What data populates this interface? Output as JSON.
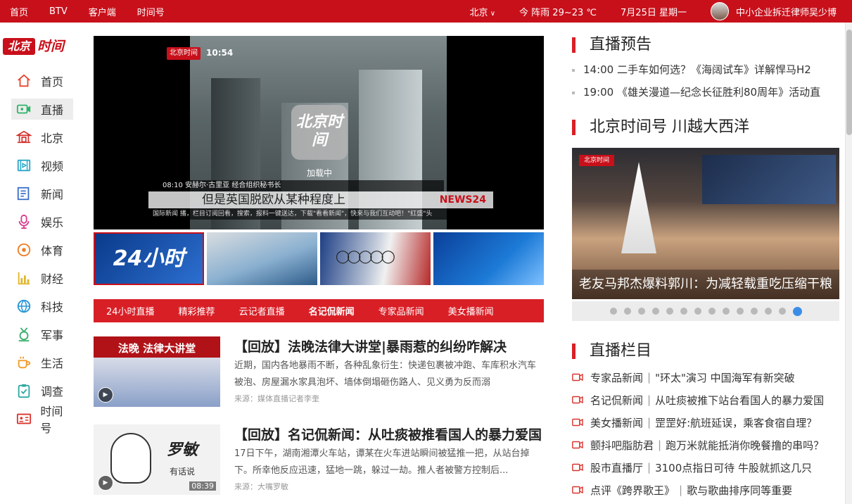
{
  "topbar": {
    "left": [
      "首页",
      "BTV",
      "客户端",
      "时间号"
    ],
    "city": "北京",
    "weather": "今 阵雨 29~23 ℃",
    "date": "7月25日  星期一",
    "user": "中小企业拆迁律师吴少博"
  },
  "logo": {
    "boxed": "北京",
    "rest": "时间"
  },
  "nav": [
    {
      "label": "首页",
      "icon": "home-icon"
    },
    {
      "label": "直播",
      "icon": "live-camera-icon"
    },
    {
      "label": "北京",
      "icon": "beijing-temple-icon"
    },
    {
      "label": "视频",
      "icon": "video-film-icon"
    },
    {
      "label": "新闻",
      "icon": "news-icon"
    },
    {
      "label": "娱乐",
      "icon": "microphone-icon"
    },
    {
      "label": "体育",
      "icon": "ball-icon"
    },
    {
      "label": "财经",
      "icon": "bar-chart-icon"
    },
    {
      "label": "科技",
      "icon": "globe-icon"
    },
    {
      "label": "军事",
      "icon": "medal-icon"
    },
    {
      "label": "生活",
      "icon": "coffee-cup-icon"
    },
    {
      "label": "调查",
      "icon": "clipboard-check-icon"
    },
    {
      "label": "时间号",
      "icon": "id-card-icon"
    }
  ],
  "player": {
    "tv_logo": "北京时间",
    "tv_time": "10:54",
    "caption_top": "08:10  安赫尔·古里亚 经合组织秘书长",
    "caption_main": "但是英国脱欧从某种程度上",
    "caption_brand": "NEWS24",
    "caption_bottom": "国际新闻 播，栏目订阅回看，搜索，报料一键送达，下载\"看看新闻\"，快来与我们互动吧！\"红盛\"头",
    "loader_logo": "北京时间",
    "loading": "加载中"
  },
  "thumbs": {
    "first_label": "24小时"
  },
  "tabs": [
    "24小时直播",
    "精彩推荐",
    "云记者直播",
    "名记侃新闻",
    "专家品新闻",
    "美女播新闻"
  ],
  "news": [
    {
      "img_title": "法晚 法律大讲堂",
      "title": "【回放】法晚法律大讲堂|暴雨惹的纠纷咋解决",
      "desc": "近期，国内各地暴雨不断，各种乱象衍生：快递包裹被冲跑、车库积水汽车被泡、房屋漏水家具泡坏、墙体倒塌砸伤路人、见义勇为反而溺",
      "source": "来源：媒体直播记者李奎"
    },
    {
      "img_title": "罗敏",
      "img_sub": "有话说",
      "duration": "08:39",
      "title": "【回放】名记侃新闻：从吐痰被推看国人的暴力爱国",
      "desc": "17日下午，湖南湘潭火车站，谭某在火车进站瞬间被猛推一把，从站台掉下。所幸他反应迅速，猛地一跳，躲过一劫。推人者被警方控制后...",
      "source": "来源：大嘴罗敏"
    }
  ],
  "right": {
    "preview_title": "直播预告",
    "preview": [
      "14:00 二手车如何选？《海阔试车》详解悍马H2",
      "19:00 《雄关漫道—纪念长征胜利80周年》活动直"
    ],
    "feature_title": "北京时间号 川越大西洋",
    "feature_caption": "老友马邦杰爆料郭川：为减轻载重吃压缩干粮",
    "feature_tag": "北京时间",
    "dots_total": 14,
    "dots_active": 14,
    "columns_title": "直播栏目",
    "columns": [
      {
        "name": "专家品新闻",
        "topic": "\"环太\"演习 中国海军有新突破"
      },
      {
        "name": "名记侃新闻",
        "topic": "从吐痰被推下站台看国人的暴力爱国"
      },
      {
        "name": "美女播新闻",
        "topic": "罡罡好:航班延误，乘客食宿自理？"
      },
      {
        "name": "颤抖吧脂肪君",
        "topic": "跑万米就能抵消你晚餐撸的串吗？"
      },
      {
        "name": "股市直播厅",
        "topic": "3100点指日可待 牛股就抓这几只"
      },
      {
        "name": "点评《跨界歌王》",
        "topic": "歌与歌曲排序同等重要"
      }
    ]
  },
  "colors": {
    "brand": "#c8101b",
    "tab_bar": "#d91f26",
    "dot_active": "#3b8ee8"
  }
}
